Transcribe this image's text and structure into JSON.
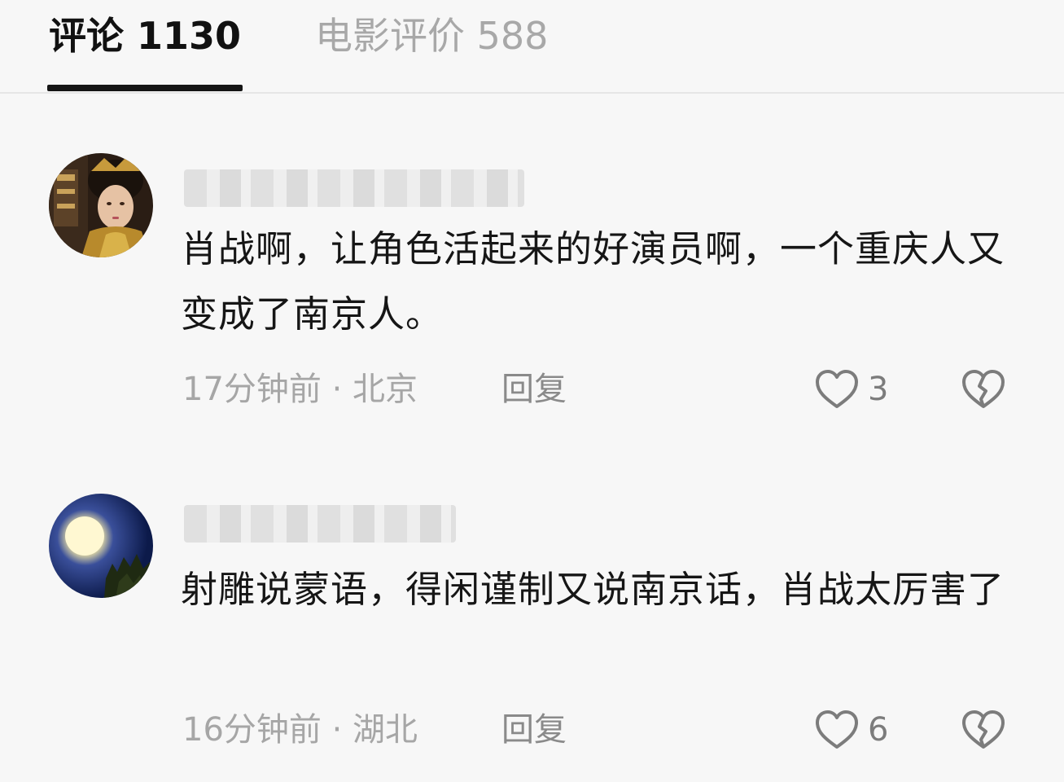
{
  "tabs": {
    "comments_label": "评论 1130",
    "reviews_label": "电影评价 588"
  },
  "comments": [
    {
      "text": "肖战啊，让角色活起来的好演员啊，一个重庆人又变成了南京人。",
      "meta": "17分钟前 · 北京",
      "reply_label": "回复",
      "likes": "3"
    },
    {
      "text": "射雕说蒙语，得闲谨制又说南京话，肖战太厉害了",
      "meta": "16分钟前 · 湖北",
      "reply_label": "回复",
      "likes": "6"
    }
  ],
  "colors": {
    "active_tab": "#111111",
    "inactive_tab": "#a8a8a8",
    "meta_text": "#a6a6a6",
    "background": "#f7f7f7"
  },
  "icons": {
    "like": "heart-outline-icon",
    "dislike": "broken-heart-icon"
  }
}
